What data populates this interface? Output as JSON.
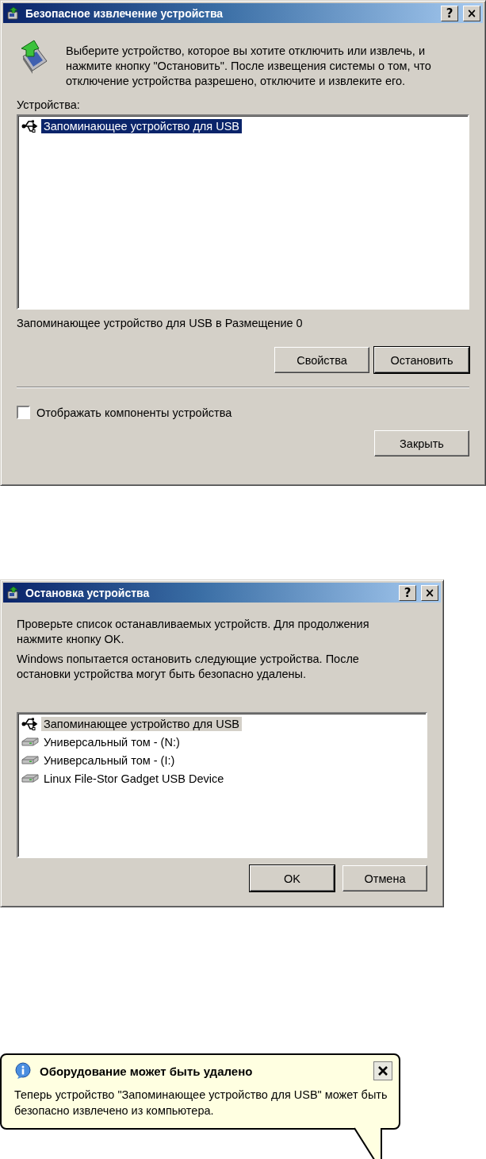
{
  "remove_dialog": {
    "title": "Безопасное извлечение устройства",
    "help_button": "?",
    "close_button": "×",
    "intro": "Выберите устройство, которое вы хотите отключить или извлечь, и нажмите кнопку \"Остановить\". После извещения системы о том, что отключение устройства разрешено, отключите и извлеките его.",
    "devices_label": "Устройства:",
    "list_focused": true,
    "devices": [
      {
        "kind": "usb",
        "label": "Запоминающее устройство для USB",
        "selected": true
      }
    ],
    "status": "Запоминающее устройство для USB в Размещение 0",
    "buttons": [
      {
        "label": "Свойства",
        "default": false
      },
      {
        "label": "Остановить",
        "default": true
      }
    ],
    "show_components": {
      "label": "Отображать компоненты устройства",
      "checked": false
    },
    "close": "Закрыть"
  },
  "stop_dialog": {
    "title": "Остановка устройства",
    "help_button": "?",
    "close_button": "×",
    "paragraphs": [
      "Проверьте список останавливаемых устройств. Для продолжения нажмите кнопку OK.",
      "Windows попытается остановить следующие устройства. После остановки устройства могут быть безопасно удалены."
    ],
    "list_focused": false,
    "devices": [
      {
        "kind": "usb",
        "label": "Запоминающее устройство для USB",
        "selected": true
      },
      {
        "kind": "disk",
        "label": "Универсальный том - (N:)",
        "selected": false
      },
      {
        "kind": "disk",
        "label": "Универсальный том - (I:)",
        "selected": false
      },
      {
        "kind": "disk",
        "label": "Linux File-Stor Gadget USB Device",
        "selected": false
      }
    ],
    "buttons": [
      {
        "label": "OK",
        "default": true
      },
      {
        "label": "Отмена",
        "default": false
      }
    ]
  },
  "balloon": {
    "title": "Оборудование может быть удалено",
    "message": "Теперь устройство \"Запоминающее устройство для USB\" может быть безопасно извлечено из компьютера."
  }
}
